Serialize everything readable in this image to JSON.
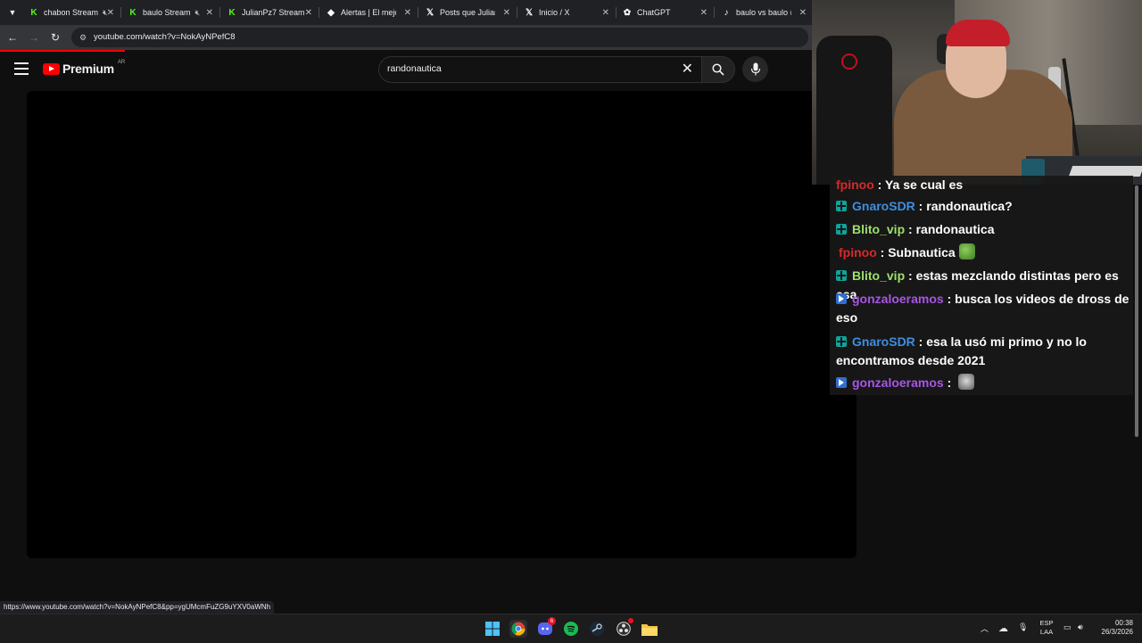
{
  "browser": {
    "tabs": [
      {
        "title": "chabon Stream",
        "icon": "kick-icon",
        "muted": true
      },
      {
        "title": "baulo Stream",
        "icon": "kick-icon",
        "muted": true
      },
      {
        "title": "JulianPz7 Stream",
        "icon": "kick-icon",
        "muted": false
      },
      {
        "title": "Alertas | El mejor",
        "icon": "alert-icon",
        "muted": false
      },
      {
        "title": "Posts que Julian (",
        "icon": "x-icon",
        "muted": false
      },
      {
        "title": "Inicio / X",
        "icon": "x-icon",
        "muted": false
      },
      {
        "title": "ChatGPT",
        "icon": "chatgpt-icon",
        "muted": false
      },
      {
        "title": "baulo vs baulo #b",
        "icon": "tiktok-icon",
        "muted": false
      }
    ],
    "url": "youtube.com/watch?v=NokAyNPefC8",
    "status_url": "https://www.youtube.com/watch?v=NokAyNPefC8&pp=ygUMcmFuZG9uYXV0aWNh"
  },
  "youtube": {
    "logo_text": "Premium",
    "region": "AR",
    "search_query": "randonautica"
  },
  "chat": {
    "messages": [
      {
        "user": "fpinoo",
        "text": "Ya se cual es",
        "color": "#d62a2a",
        "badge": "none"
      },
      {
        "user": "GnaroSDR",
        "text": "randonautica?",
        "color": "#3e8ee0",
        "badge": "mod"
      },
      {
        "user": "Blito_vip",
        "text": "randonautica",
        "color": "#9ee06b",
        "badge": "mod"
      },
      {
        "user": "fpinoo",
        "text": "Subnautica",
        "color": "#d62a2a",
        "badge": "none",
        "emote": "frog-emote"
      },
      {
        "user": "Blito_vip",
        "text": "estas mezclando distintas pero es esa",
        "color": "#9ee06b",
        "badge": "mod"
      },
      {
        "user": "gonzaloeramos",
        "text": "busca los videos de dross de eso",
        "color": "#a855e6",
        "badge": "prime"
      },
      {
        "user": "GnaroSDR",
        "text": "esa la usó mi primo y no lo encontramos desde 2021",
        "color": "#3e8ee0",
        "badge": "mod"
      },
      {
        "user": "gonzaloeramos",
        "text": "",
        "color": "#a855e6",
        "badge": "prime",
        "emote": "skull-emote"
      }
    ]
  },
  "taskbar": {
    "apps": [
      "windows-start",
      "chrome",
      "discord",
      "spotify",
      "steam",
      "obs",
      "file-explorer"
    ],
    "discord_badge": "6",
    "lang_line1": "ESP",
    "lang_line2": "LAA",
    "time": "00:38",
    "date": "26/3/2026"
  },
  "colors": {
    "youtube_red": "#ff0000",
    "accent": "#3e8ee0"
  }
}
